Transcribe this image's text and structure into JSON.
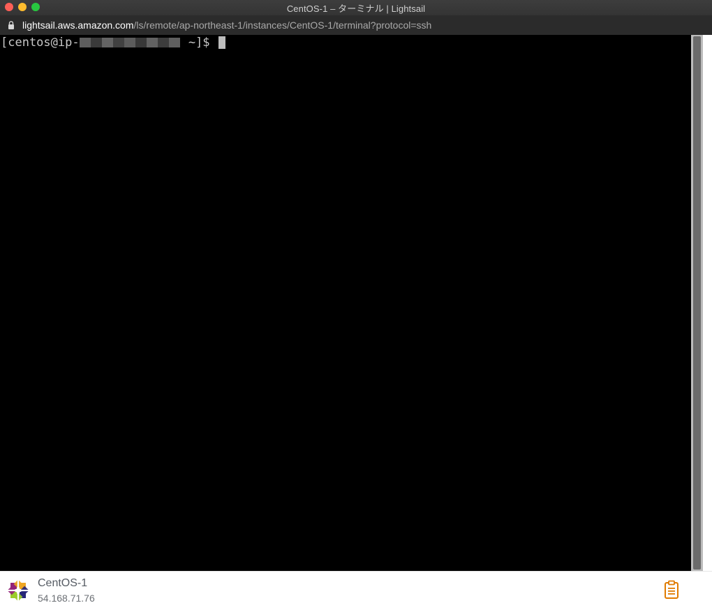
{
  "window": {
    "title": "CentOS-1 – ターミナル | Lightsail"
  },
  "urlbar": {
    "host": "lightsail.aws.amazon.com",
    "path": "/ls/remote/ap-northeast-1/instances/CentOS-1/terminal?protocol=ssh"
  },
  "terminal": {
    "prompt_start": "[centos@ip-",
    "prompt_end": " ~]$"
  },
  "footer": {
    "instance_name": "CentOS-1",
    "ip_address": "54.168.71.76"
  },
  "colors": {
    "terminal_bg": "#000000",
    "clipboard_icon": "#e07b00"
  },
  "icons": {
    "logo": "centos-logo",
    "clipboard": "clipboard-icon"
  }
}
